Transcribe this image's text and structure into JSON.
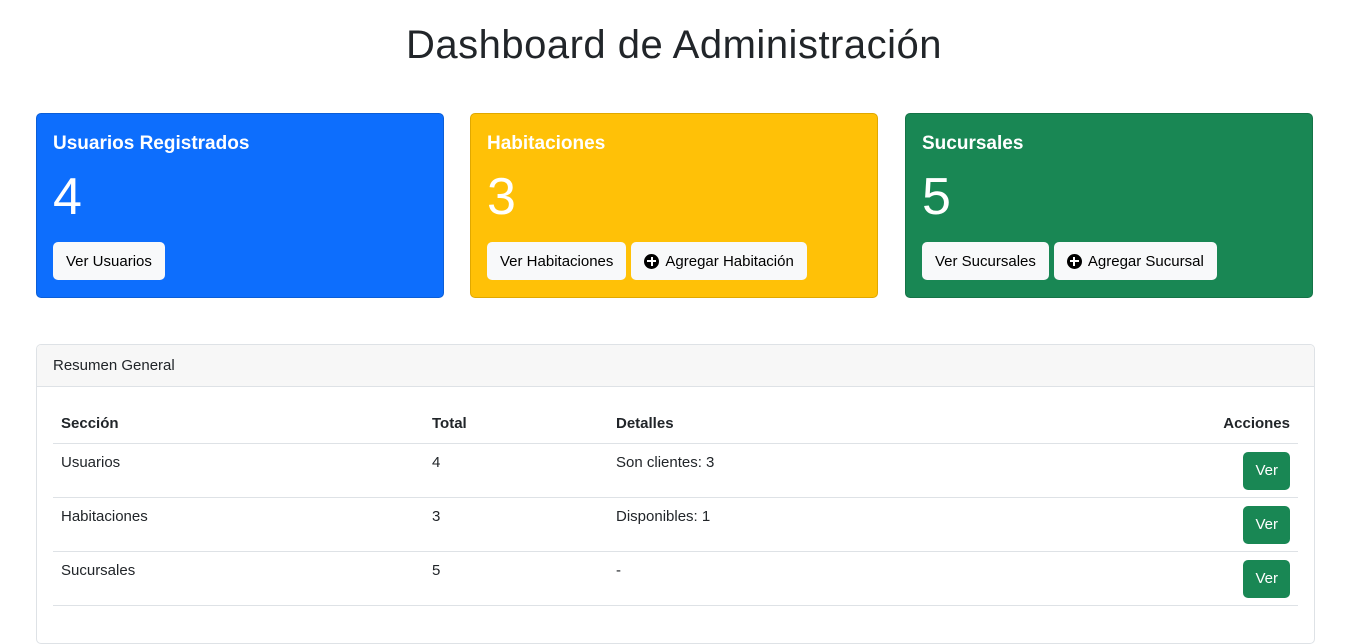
{
  "page": {
    "title": "Dashboard de Administración"
  },
  "cards": {
    "usuarios": {
      "title": "Usuarios Registrados",
      "count": "4",
      "view_label": "Ver Usuarios",
      "color": "#0d6efd"
    },
    "habitaciones": {
      "title": "Habitaciones",
      "count": "3",
      "view_label": "Ver Habitaciones",
      "add_label": "Agregar Habitación",
      "add_icon": "plus-circle-icon",
      "color": "#ffc107"
    },
    "sucursales": {
      "title": "Sucursales",
      "count": "5",
      "view_label": "Ver Sucursales",
      "add_label": "Agregar Sucursal",
      "add_icon": "plus-circle-icon",
      "color": "#198754"
    }
  },
  "summary": {
    "header": "Resumen General",
    "columns": [
      "Sección",
      "Total",
      "Detalles",
      "Acciones"
    ],
    "rows": [
      {
        "section": "Usuarios",
        "total": "4",
        "details": "Son clientes: 3",
        "action": "Ver"
      },
      {
        "section": "Habitaciones",
        "total": "3",
        "details": "Disponibles: 1",
        "action": "Ver"
      },
      {
        "section": "Sucursales",
        "total": "5",
        "details": "-",
        "action": "Ver"
      }
    ]
  }
}
